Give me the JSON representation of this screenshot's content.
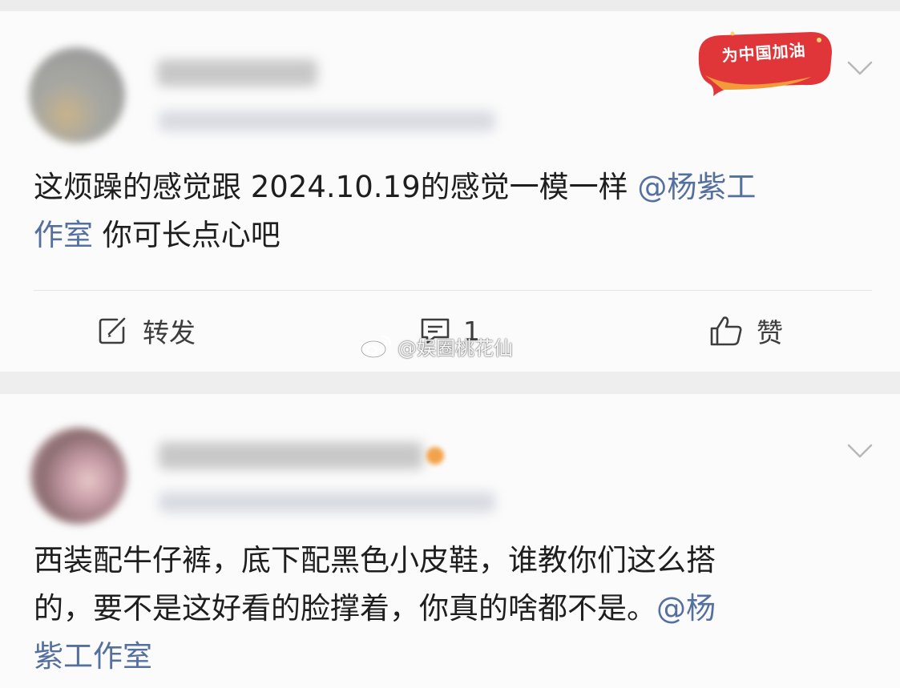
{
  "badge": {
    "text": "为中国加油"
  },
  "posts": [
    {
      "text_line1": "这烦躁的感觉跟 2024.10.19的感觉一模一样 ",
      "mention_part1": "@杨紫工",
      "mention_part2": "作室",
      "text_line2_rest": " 你可长点心吧",
      "actions": {
        "repost_label": "转发",
        "comment_count": "1",
        "like_label": "赞"
      }
    },
    {
      "text_line1": "西装配牛仔裤，底下配黑色小皮鞋，谁教你们这么搭",
      "text_line2": "的，要不是这好看的脸撑着，你真的啥都不是。",
      "mention_part1": "@杨",
      "mention_part2": "紫工作室"
    }
  ],
  "watermark": {
    "text": "@娱圈桃花仙",
    "icon": "weibo-logo-icon"
  },
  "icons": {
    "repost": "repost-icon",
    "comment": "comment-icon",
    "like": "thumbs-up-icon",
    "more": "chevron-down-icon"
  },
  "colors": {
    "mention": "#55709f",
    "badge_red": "#e0363a",
    "badge_orange": "#f39a3a",
    "background": "#eeeeee",
    "card": "#fbfbfb"
  }
}
